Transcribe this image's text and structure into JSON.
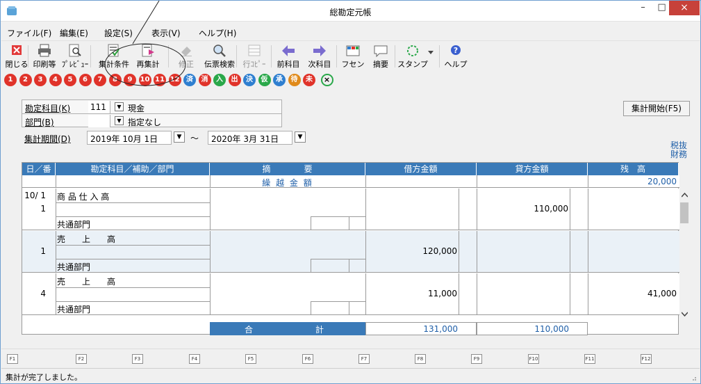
{
  "window": {
    "title": "総勘定元帳",
    "min": "–",
    "max": "□",
    "close": "×"
  },
  "menu": [
    {
      "label": "ファイル(F)"
    },
    {
      "label": "編集(E)"
    },
    {
      "label": "設定(S)"
    },
    {
      "label": "表示(V)"
    },
    {
      "label": "ヘルプ(H)"
    }
  ],
  "toolbar": [
    {
      "label": "閉じる",
      "icon": "close-x-icon",
      "enabled": true
    },
    {
      "label": "印刷等",
      "icon": "printer-icon",
      "enabled": true
    },
    {
      "label": "ﾌﾟﾚﾋﾞｭｰ",
      "icon": "preview-magnifier-icon",
      "enabled": true
    },
    {
      "label": "集計条件",
      "icon": "filter-conditions-icon",
      "enabled": true
    },
    {
      "label": "再集計",
      "icon": "recalculate-icon",
      "enabled": true
    },
    {
      "label": "修正",
      "icon": "edit-eraser-icon",
      "enabled": false
    },
    {
      "label": "伝票検索",
      "icon": "voucher-search-icon",
      "enabled": true
    },
    {
      "label": "行ｺﾋﾟｰ",
      "icon": "row-copy-icon",
      "enabled": false
    },
    {
      "label": "前科目",
      "icon": "previous-account-arrow-icon",
      "enabled": true
    },
    {
      "label": "次科目",
      "icon": "next-account-arrow-icon",
      "enabled": true
    },
    {
      "label": "フセン",
      "icon": "sticky-note-icon",
      "enabled": true
    },
    {
      "label": "摘要",
      "icon": "speech-bubble-icon",
      "enabled": true
    },
    {
      "label": "スタンプ",
      "icon": "stamp-circle-icon",
      "enabled": true
    },
    {
      "label": "ヘルプ",
      "icon": "help-icon",
      "enabled": true
    }
  ],
  "stamps": [
    {
      "glyph": "1",
      "color": "#e0332a"
    },
    {
      "glyph": "2",
      "color": "#e0332a"
    },
    {
      "glyph": "3",
      "color": "#e0332a"
    },
    {
      "glyph": "4",
      "color": "#e0332a"
    },
    {
      "glyph": "5",
      "color": "#e0332a"
    },
    {
      "glyph": "6",
      "color": "#e0332a"
    },
    {
      "glyph": "7",
      "color": "#e0332a"
    },
    {
      "glyph": "8",
      "color": "#e0332a"
    },
    {
      "glyph": "9",
      "color": "#e0332a"
    },
    {
      "glyph": "10",
      "color": "#e0332a"
    },
    {
      "glyph": "11",
      "color": "#e0332a"
    },
    {
      "glyph": "12",
      "color": "#e0332a"
    },
    {
      "glyph": "済",
      "color": "#2f7fd0"
    },
    {
      "glyph": "消",
      "color": "#e0332a"
    },
    {
      "glyph": "入",
      "color": "#2aa84a"
    },
    {
      "glyph": "出",
      "color": "#e0332a"
    },
    {
      "glyph": "決",
      "color": "#2f7fd0"
    },
    {
      "glyph": "仮",
      "color": "#2aa84a"
    },
    {
      "glyph": "承",
      "color": "#2f7fd0"
    },
    {
      "glyph": "待",
      "color": "#e08a1a"
    },
    {
      "glyph": "未",
      "color": "#e0332a"
    }
  ],
  "form": {
    "account_label": "勘定科目(K)",
    "account_code": "111",
    "account_name": "現金",
    "dept_label": "部門(B)",
    "dept_code": "",
    "dept_name": "指定なし",
    "period_label": "集計期間(D)",
    "period_from": "2019年 10月  1日",
    "tilde": "～",
    "period_to": "2020年  3月 31日",
    "start_button": "集計開始(F5)",
    "tax_line1": "税抜",
    "tax_line2": "財務"
  },
  "table": {
    "headers": [
      "日／番",
      "勘定科目／補助／部門",
      "摘　　　　要",
      "借方金額",
      "貸方金額",
      "残　高"
    ],
    "carry_label": "繰 越 金 額",
    "carry_balance": "20,000",
    "rows": [
      {
        "date": "10/ 1",
        "num": "1",
        "account": "商 品 仕 入 高",
        "dept": "共通部門",
        "debit": "",
        "credit": "110,000",
        "balance": ""
      },
      {
        "date": "",
        "num": "1",
        "account": "売　　上　　高",
        "dept": "共通部門",
        "debit": "120,000",
        "credit": "",
        "balance": ""
      },
      {
        "date": "",
        "num": "4",
        "account": "売　　上　　高",
        "dept": "共通部門",
        "debit": "11,000",
        "credit": "",
        "balance": "41,000"
      }
    ],
    "total_label_left": "合",
    "total_label_right": "計",
    "total_debit": "131,000",
    "total_credit": "110,000"
  },
  "fkeys": [
    "F1",
    "F2",
    "F3",
    "F4",
    "F5",
    "F6",
    "F7",
    "F8",
    "F9",
    "F10",
    "F11",
    "F12"
  ],
  "status": "集計が完了しました。"
}
